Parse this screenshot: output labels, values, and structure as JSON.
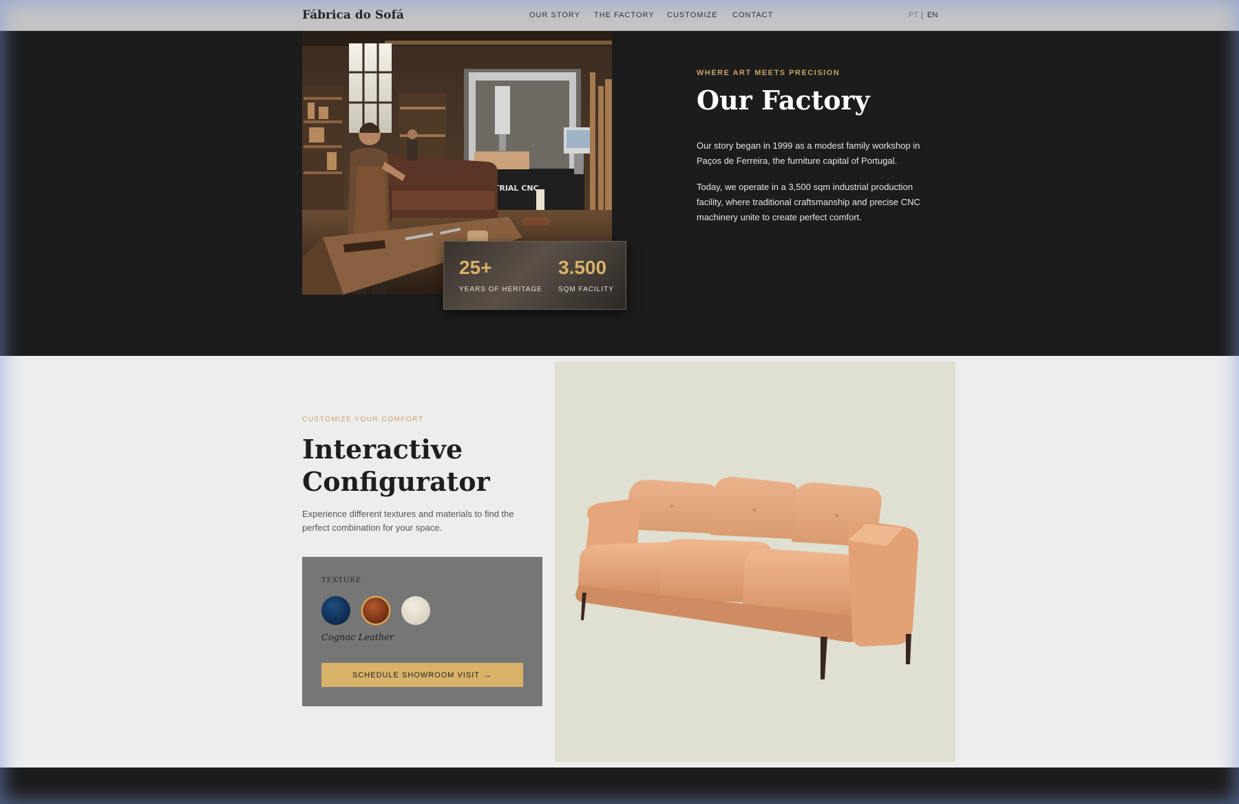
{
  "nav": {
    "brand": "Fábrica do Sofá",
    "links": [
      "OUR STORY",
      "THE FACTORY",
      "CUSTOMIZE",
      "CONTACT"
    ],
    "lang_pt": "PT",
    "lang_sep": "|",
    "lang_en": "EN"
  },
  "factory": {
    "eyebrow": "WHERE ART MEETS PRECISION",
    "title": "Our Factory",
    "p1": "Our story began in 1999 as a modest family workshop in Paços de Ferreira, the furniture capital of Portugal.",
    "p2": "Today, we operate in a 3,500 sqm industrial production facility, where traditional craftsmanship and precise CNC machinery unite to create perfect comfort.",
    "cnc_label": "USTRIAL CNC",
    "stats": [
      {
        "value": "25+",
        "label": "YEARS OF HERITAGE"
      },
      {
        "value": "3.500",
        "label": "SQM FACILITY"
      }
    ]
  },
  "configurator": {
    "eyebrow": "CUSTOMIZE YOUR COMFORT",
    "title": "Interactive Configurator",
    "description": "Experience different textures and materials to find the perfect combination for your space.",
    "texture_label": "TEXTURE",
    "selected": "Cognac Leather",
    "cta": "SCHEDULE SHOWROOM VISIT",
    "cta_arrow": "→"
  },
  "colors": {
    "accent_gold": "#d9b26a",
    "dark_bg": "#1c1c1c",
    "light_bg": "#ededed",
    "sofa": "#e3a77c",
    "swatch_navy": "#0d2a4f",
    "swatch_cognac": "#8a3a18",
    "swatch_linen": "#e6e0d0"
  }
}
